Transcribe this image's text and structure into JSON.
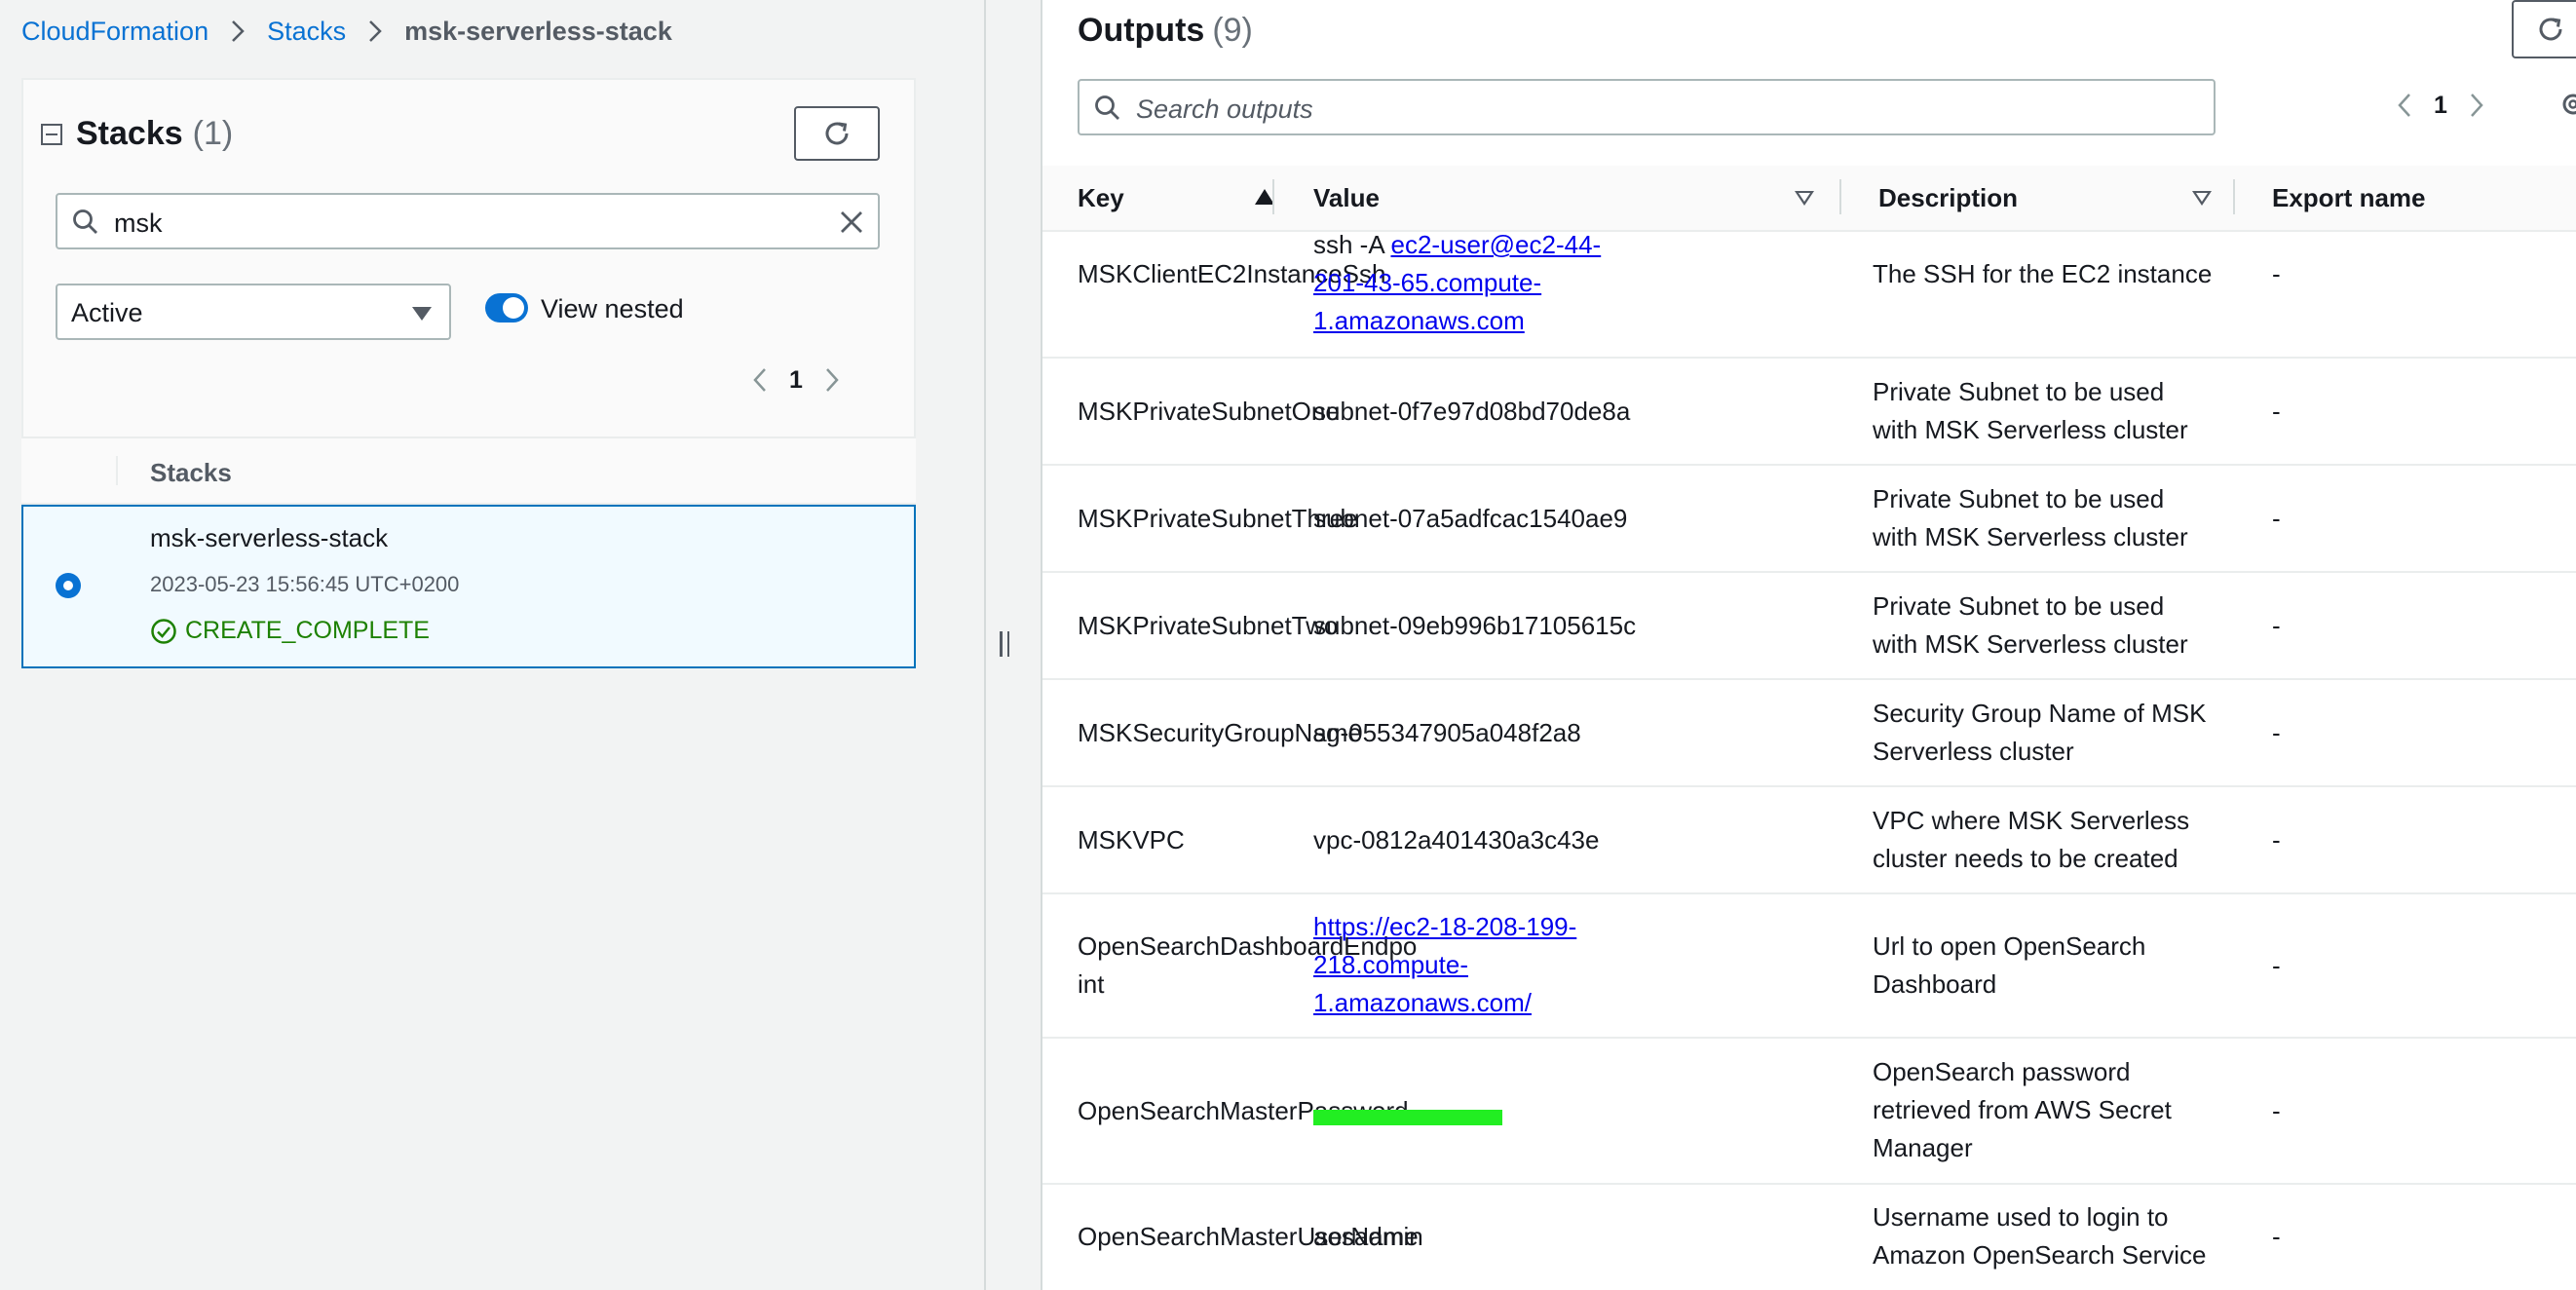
{
  "breadcrumb": {
    "items": [
      {
        "label": "CloudFormation"
      },
      {
        "label": "Stacks"
      },
      {
        "label": "msk-serverless-stack"
      }
    ]
  },
  "stacks_panel": {
    "title": "Stacks",
    "count": "(1)",
    "search_value": "msk",
    "filter_selected": "Active",
    "toggle_label": "View nested",
    "toggle_on": true,
    "page": "1",
    "column_header": "Stacks",
    "rows": [
      {
        "name": "msk-serverless-stack",
        "timestamp": "2023-05-23 15:56:45 UTC+0200",
        "status": "CREATE_COMPLETE",
        "selected": true
      }
    ]
  },
  "outputs_panel": {
    "title": "Outputs",
    "count": "(9)",
    "search_placeholder": "Search outputs",
    "page": "1",
    "columns": {
      "key": "Key",
      "value": "Value",
      "description": "Description",
      "export": "Export name"
    },
    "rows": [
      {
        "key": "MSKClientEC2InstanceSsh",
        "value_prefix": "ssh -A ",
        "value_link": [
          "ec2-user@ec2-44-",
          "201-43-65.compute-",
          "1.amazonaws.com"
        ],
        "description": [
          "The SSH for the EC2 instance"
        ],
        "export": "-"
      },
      {
        "key": "MSKPrivateSubnetOne",
        "value": "subnet-0f7e97d08bd70de8a",
        "description": [
          "Private Subnet to be used",
          "with MSK Serverless cluster"
        ],
        "export": "-"
      },
      {
        "key": "MSKPrivateSubnetThree",
        "value": "subnet-07a5adfcac1540ae9",
        "description": [
          "Private Subnet to be used",
          "with MSK Serverless cluster"
        ],
        "export": "-"
      },
      {
        "key": "MSKPrivateSubnetTwo",
        "value": "subnet-09eb996b17105615c",
        "description": [
          "Private Subnet to be used",
          "with MSK Serverless cluster"
        ],
        "export": "-"
      },
      {
        "key": "MSKSecurityGroupName",
        "value": "sg-055347905a048f2a8",
        "description": [
          "Security Group Name of MSK",
          "Serverless cluster"
        ],
        "export": "-"
      },
      {
        "key": "MSKVPC",
        "value": "vpc-0812a401430a3c43e",
        "description": [
          "VPC where MSK Serverless",
          "cluster needs to be created"
        ],
        "export": "-"
      },
      {
        "key": [
          "OpenSearchDashboardEndpo",
          "int"
        ],
        "value_link": [
          "https://ec2-18-208-199-",
          "218.compute-",
          "1.amazonaws.com/"
        ],
        "description": [
          "Url to open OpenSearch",
          "Dashboard"
        ],
        "export": "-"
      },
      {
        "key": "OpenSearchMasterPassword",
        "value_redacted": true,
        "description": [
          "OpenSearch password",
          "retrieved from AWS Secret",
          "Manager"
        ],
        "export": "-"
      },
      {
        "key": "OpenSearchMasterUserName",
        "value": "aosadmin",
        "description": [
          "Username used to login to",
          "Amazon OpenSearch Service"
        ],
        "export": "-"
      }
    ]
  },
  "colors": {
    "link_blue": "#0972d3",
    "success_green": "#1d8102",
    "selected_row_bg": "#f1faff",
    "selected_row_border": "#0073bb",
    "redaction_green": "#22ee22"
  }
}
